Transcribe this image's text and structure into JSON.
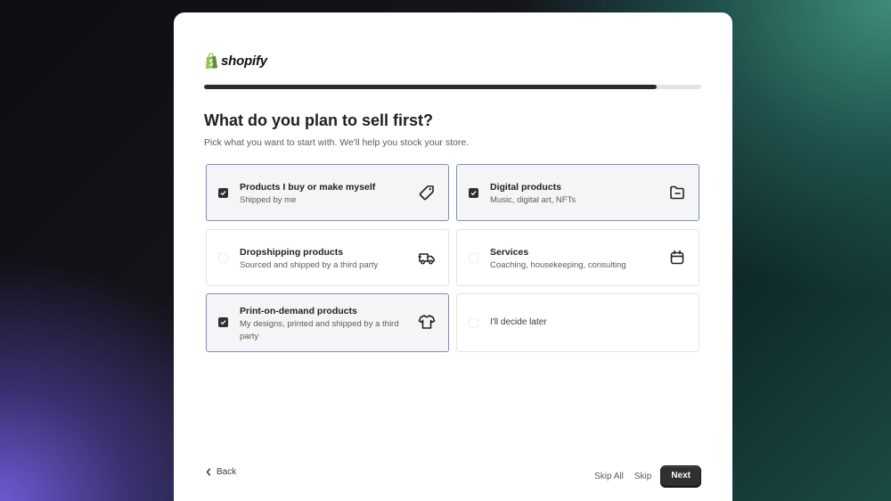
{
  "brand": {
    "name": "shopify",
    "logo_color": "#95bf47"
  },
  "progress": {
    "fraction": 0.91
  },
  "title": "What do you plan to sell first?",
  "subtitle": "Pick what you want to start with. We'll help you stock your store.",
  "options": [
    {
      "title": "Products I buy or make myself",
      "desc": "Shipped by me",
      "selected": true,
      "icon": "tag-icon"
    },
    {
      "title": "Digital products",
      "desc": "Music, digital art, NFTs",
      "selected": true,
      "icon": "folder-icon"
    },
    {
      "title": "Dropshipping products",
      "desc": "Sourced and shipped by a third party",
      "selected": false,
      "icon": "truck-icon"
    },
    {
      "title": "Services",
      "desc": "Coaching, housekeeping, consulting",
      "selected": false,
      "icon": "calendar-icon"
    },
    {
      "title": "Print-on-demand products",
      "desc": "My designs, printed and shipped by a third party",
      "selected": true,
      "icon": "tshirt-icon"
    },
    {
      "title": "I'll decide later",
      "desc": "",
      "selected": false,
      "icon": ""
    }
  ],
  "footer": {
    "back": "Back",
    "skip_all": "Skip All",
    "skip": "Skip",
    "next": "Next"
  }
}
